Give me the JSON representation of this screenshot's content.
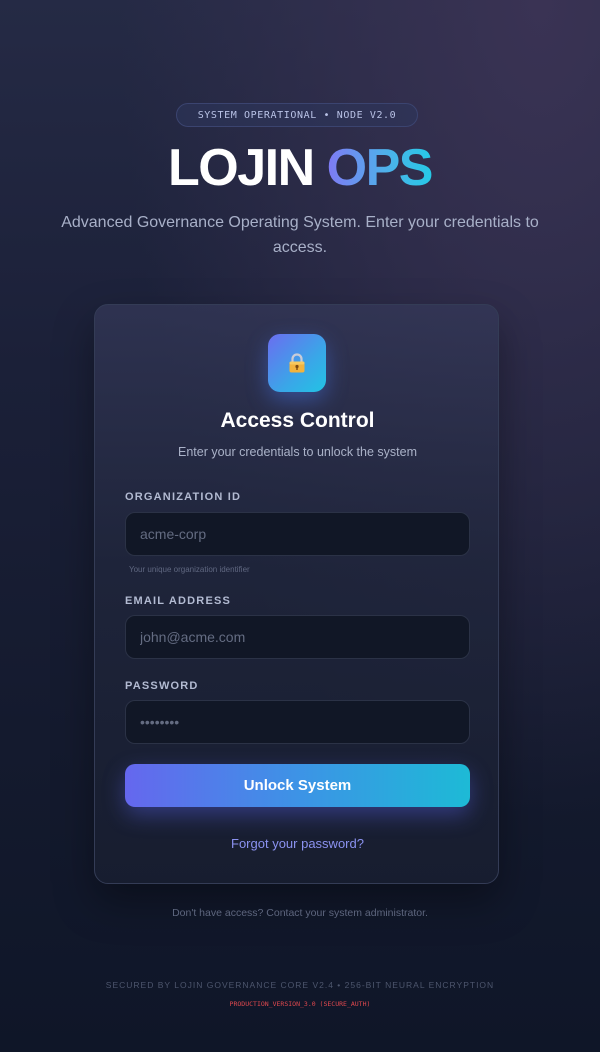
{
  "status_badge": "SYSTEM OPERATIONAL • NODE V2.0",
  "brand": {
    "part1": "LOJIN",
    "part2": "OPS"
  },
  "subtitle": "Advanced Governance Operating System. Enter your credentials to access.",
  "card": {
    "icon": "lock-icon",
    "title": "Access Control",
    "subtitle": "Enter your credentials to unlock the system",
    "org": {
      "label": "ORGANIZATION ID",
      "placeholder": "acme-corp",
      "hint": "Your unique organization identifier"
    },
    "email": {
      "label": "EMAIL ADDRESS",
      "placeholder": "john@acme.com"
    },
    "password": {
      "label": "PASSWORD",
      "placeholder": "••••••••"
    },
    "submit_label": "Unlock System",
    "forgot_label": "Forgot your password?"
  },
  "no_access": "Don't have access? Contact your system administrator.",
  "footer": "SECURED BY LOJIN GOVERNANCE CORE V2.4 • 256-BIT NEURAL ENCRYPTION",
  "version": "PRODUCTION_VERSION_3.0 (SECURE_AUTH)",
  "colors": {
    "accent_start": "#6567ee",
    "accent_end": "#1dbad6",
    "link": "#8b92f0",
    "version_red": "#e0484e"
  }
}
